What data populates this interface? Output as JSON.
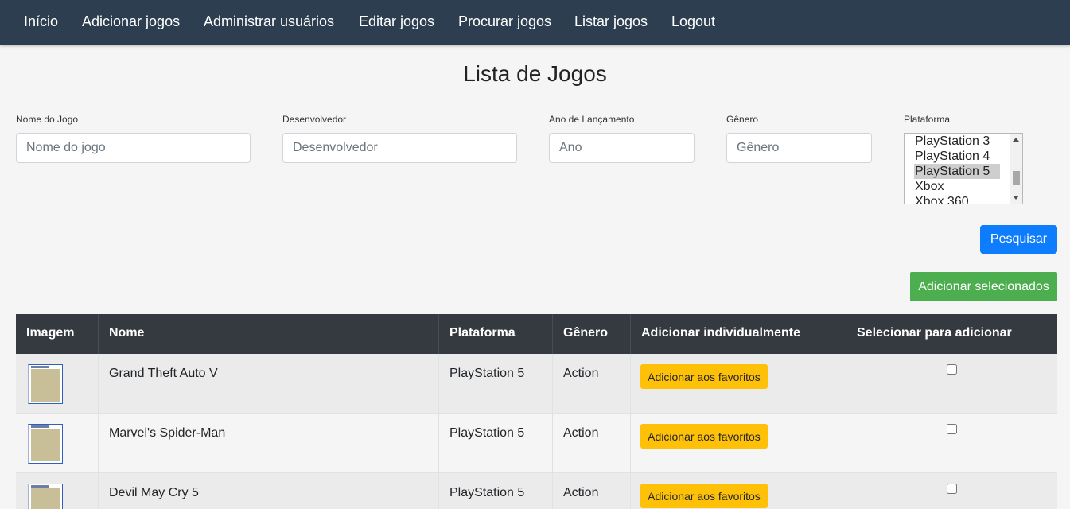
{
  "nav": {
    "items": [
      {
        "label": "Início"
      },
      {
        "label": "Adicionar jogos"
      },
      {
        "label": "Administrar usuários"
      },
      {
        "label": "Editar jogos"
      },
      {
        "label": "Procurar jogos"
      },
      {
        "label": "Listar jogos"
      },
      {
        "label": "Logout"
      }
    ]
  },
  "page": {
    "title": "Lista de Jogos"
  },
  "filters": {
    "name": {
      "label": "Nome do Jogo",
      "placeholder": "Nome do jogo",
      "value": ""
    },
    "developer": {
      "label": "Desenvolvedor",
      "placeholder": "Desenvolvedor",
      "value": ""
    },
    "year": {
      "label": "Ano de Lançamento",
      "placeholder": "Ano",
      "value": ""
    },
    "genre": {
      "label": "Gênero",
      "placeholder": "Gênero",
      "value": ""
    },
    "platform": {
      "label": "Plataforma",
      "options": [
        "PlayStation 3",
        "PlayStation 4",
        "PlayStation 5",
        "Xbox",
        "Xbox 360"
      ],
      "selected": "PlayStation 5"
    },
    "search_button": "Pesquisar"
  },
  "add_selected_button": "Adicionar selecionados",
  "table": {
    "headers": [
      "Imagem",
      "Nome",
      "Plataforma",
      "Gênero",
      "Adicionar individualmente",
      "Selecionar para adicionar"
    ],
    "rows": [
      {
        "name": "Grand Theft Auto V",
        "platform": "PlayStation 5",
        "genre": "Action",
        "fav_button": "Adicionar aos favoritos",
        "checked": false
      },
      {
        "name": "Marvel's Spider-Man",
        "platform": "PlayStation 5",
        "genre": "Action",
        "fav_button": "Adicionar aos favoritos",
        "checked": false
      },
      {
        "name": "Devil May Cry 5",
        "platform": "PlayStation 5",
        "genre": "Action",
        "fav_button": "Adicionar aos favoritos",
        "checked": false
      }
    ]
  },
  "colors": {
    "navbar": "#2c3e50",
    "search_button": "#0d7cfd",
    "add_selected_button": "#4cae4f",
    "favorite_button": "#ffc107",
    "table_header": "#343a40"
  },
  "icons": {
    "row_image": "game-cover-thumbnail",
    "scroll_up": "arrow-up-icon",
    "scroll_down": "arrow-down-icon"
  }
}
